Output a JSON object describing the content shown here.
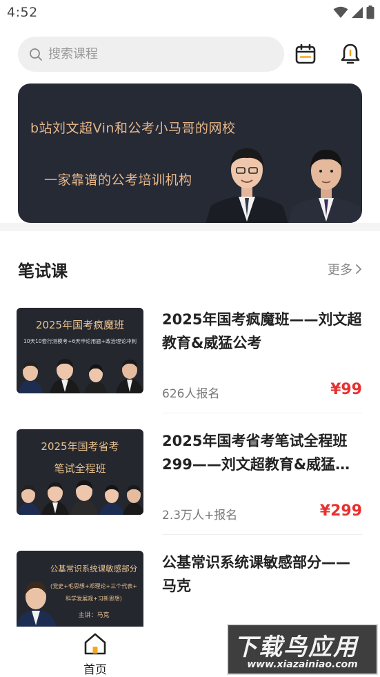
{
  "status_bar": {
    "time": "4:52",
    "icons": [
      "wifi-icon",
      "signal-icon",
      "battery-icon"
    ]
  },
  "header": {
    "search_placeholder": "搜索课程",
    "icons": [
      "search-icon",
      "calendar-icon",
      "bell-icon"
    ]
  },
  "banner": {
    "line1": "b站刘文超Vin和公考小马哥的网校",
    "line2": "一家靠谱的公考培训机构"
  },
  "section": {
    "title": "笔试课",
    "more_label": "更多"
  },
  "courses": [
    {
      "title": "2025年国考疯魔班——刘文超教育&威猛公考",
      "enroll": "626人报名",
      "price": "¥99",
      "thumb_title": "2025年国考疯魔班",
      "thumb_sub": "10天10套行测模考+6天申论用题+政治理论冲刺"
    },
    {
      "title": "2025年国考省考笔试全程班299——刘文超教育&威猛…",
      "enroll": "2.3万人+报名",
      "price": "¥299",
      "thumb_title": "2025年国考省考",
      "thumb_title2": "笔试全程班"
    },
    {
      "title": "公基常识系统课敏感部分——马克",
      "thumb_title": "公基常识系统课敏感部分",
      "thumb_sub": "(党史+毛思想+邓理论+三个代表+",
      "thumb_sub2": "科学发展观+习新思想)",
      "thumb_teacher": "主讲：马克"
    }
  ],
  "bottom_nav": {
    "home_label": "首页"
  },
  "watermark": {
    "big": "下载鸟应用",
    "small": "www.xiazainiao.com"
  },
  "colors": {
    "accent_price": "#e8312f",
    "banner_bg": "#262a35",
    "banner_text": "#e7b78a"
  }
}
